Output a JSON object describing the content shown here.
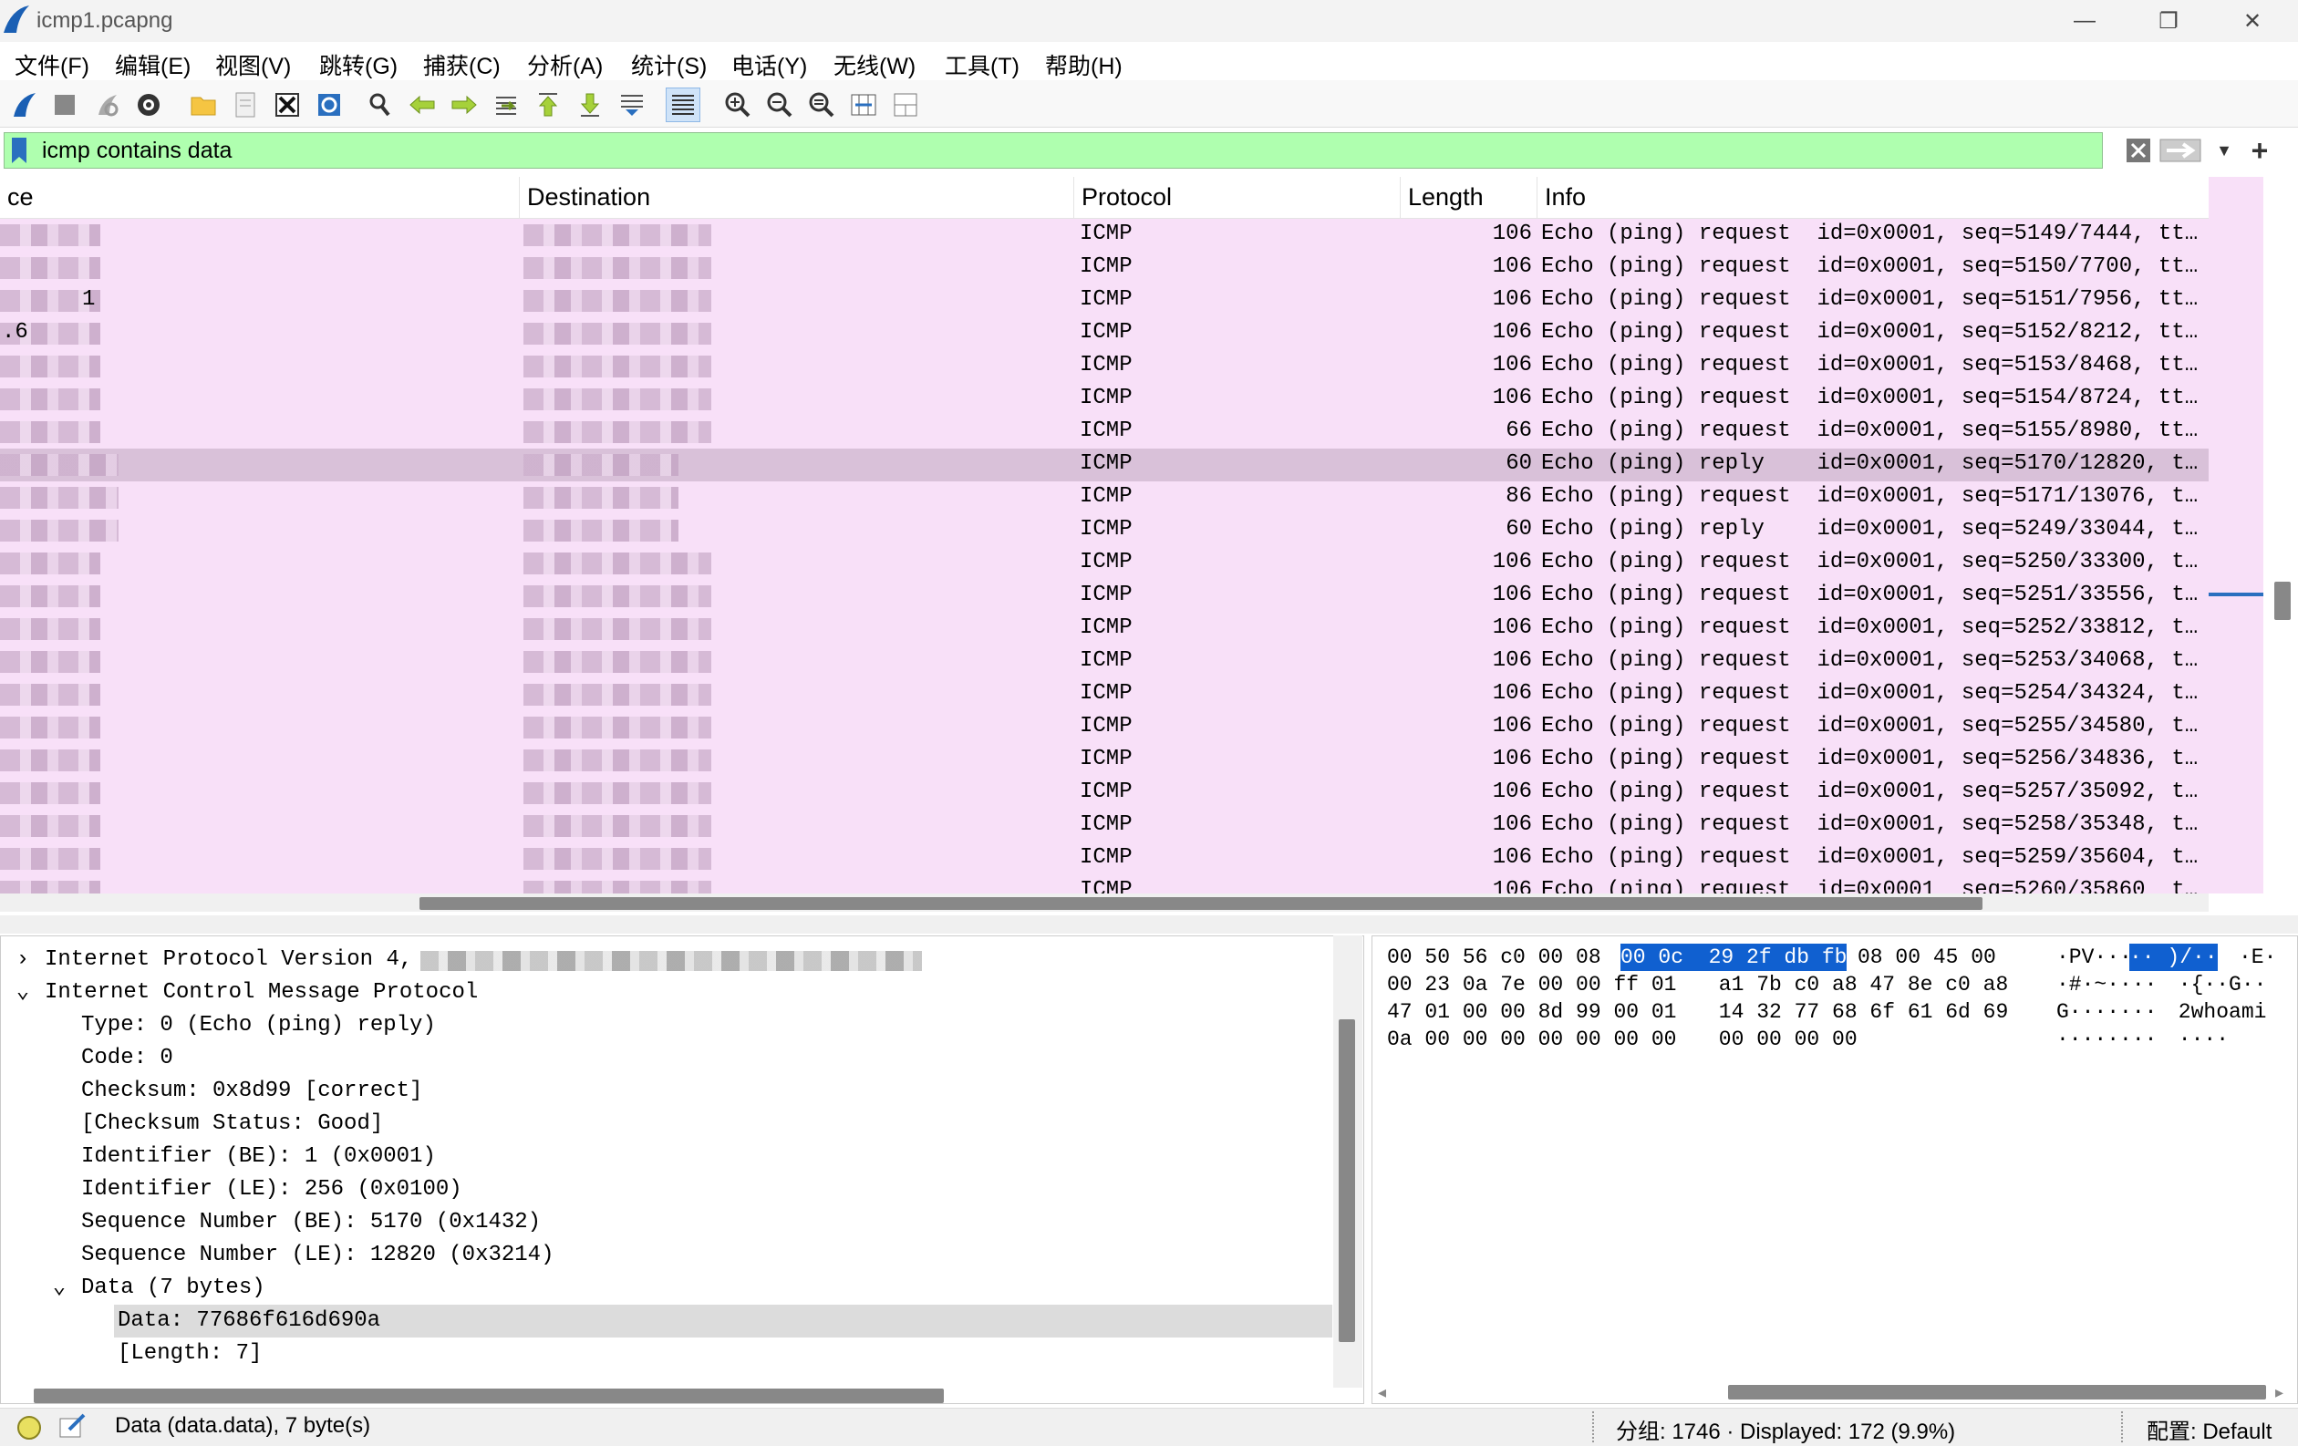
{
  "window": {
    "title": "icmp1.pcapng"
  },
  "menu": [
    {
      "label": "文件(F)"
    },
    {
      "label": "编辑(E)"
    },
    {
      "label": "视图(V)"
    },
    {
      "label": "跳转(G)"
    },
    {
      "label": "捕获(C)"
    },
    {
      "label": "分析(A)"
    },
    {
      "label": "统计(S)"
    },
    {
      "label": "电话(Y)"
    },
    {
      "label": "无线(W)"
    },
    {
      "label": "工具(T)"
    },
    {
      "label": "帮助(H)"
    }
  ],
  "toolbar": {
    "icons": [
      "shark-fin-start-icon",
      "stop-capture-icon",
      "restart-capture-icon",
      "capture-options-icon",
      "open-folder-icon",
      "save-file-icon",
      "close-file-icon",
      "reload-file-icon",
      "find-packet-icon",
      "go-back-icon",
      "go-forward-icon",
      "go-to-packet-icon",
      "go-first-icon",
      "go-last-icon",
      "autoscroll-icon",
      "colorize-icon",
      "zoom-in-icon",
      "zoom-out-icon",
      "zoom-normal-icon",
      "resize-columns-icon",
      "layout-icon"
    ]
  },
  "filter": {
    "value": "icmp contains data",
    "add_label": "+"
  },
  "packet_list": {
    "columns": [
      "ce",
      "Destination",
      "Protocol",
      "Length",
      "Info"
    ],
    "rows": [
      {
        "source": "",
        "protocol": "ICMP",
        "length": "106",
        "info": "Echo (ping) request  id=0x0001, seq=5149/7444, tt…"
      },
      {
        "source": "",
        "protocol": "ICMP",
        "length": "106",
        "info": "Echo (ping) request  id=0x0001, seq=5150/7700, tt…"
      },
      {
        "source": "1",
        "protocol": "ICMP",
        "length": "106",
        "info": "Echo (ping) request  id=0x0001, seq=5151/7956, tt…"
      },
      {
        "source": ".6",
        "protocol": "ICMP",
        "length": "106",
        "info": "Echo (ping) request  id=0x0001, seq=5152/8212, tt…"
      },
      {
        "source": "",
        "protocol": "ICMP",
        "length": "106",
        "info": "Echo (ping) request  id=0x0001, seq=5153/8468, tt…"
      },
      {
        "source": "",
        "protocol": "ICMP",
        "length": "106",
        "info": "Echo (ping) request  id=0x0001, seq=5154/8724, tt…"
      },
      {
        "source": "",
        "protocol": "ICMP",
        "length": "66",
        "info": "Echo (ping) request  id=0x0001, seq=5155/8980, tt…"
      },
      {
        "source": "",
        "protocol": "ICMP",
        "length": "60",
        "info": "Echo (ping) reply    id=0x0001, seq=5170/12820, t…"
      },
      {
        "source": "",
        "protocol": "ICMP",
        "length": "86",
        "info": "Echo (ping) request  id=0x0001, seq=5171/13076, t…"
      },
      {
        "source": "",
        "protocol": "ICMP",
        "length": "60",
        "info": "Echo (ping) reply    id=0x0001, seq=5249/33044, t…"
      },
      {
        "source": "",
        "protocol": "ICMP",
        "length": "106",
        "info": "Echo (ping) request  id=0x0001, seq=5250/33300, t…"
      },
      {
        "source": "",
        "protocol": "ICMP",
        "length": "106",
        "info": "Echo (ping) request  id=0x0001, seq=5251/33556, t…"
      },
      {
        "source": "",
        "protocol": "ICMP",
        "length": "106",
        "info": "Echo (ping) request  id=0x0001, seq=5252/33812, t…"
      },
      {
        "source": "",
        "protocol": "ICMP",
        "length": "106",
        "info": "Echo (ping) request  id=0x0001, seq=5253/34068, t…"
      },
      {
        "source": "",
        "protocol": "ICMP",
        "length": "106",
        "info": "Echo (ping) request  id=0x0001, seq=5254/34324, t…"
      },
      {
        "source": "",
        "protocol": "ICMP",
        "length": "106",
        "info": "Echo (ping) request  id=0x0001, seq=5255/34580, t…"
      },
      {
        "source": "",
        "protocol": "ICMP",
        "length": "106",
        "info": "Echo (ping) request  id=0x0001, seq=5256/34836, t…"
      },
      {
        "source": "",
        "protocol": "ICMP",
        "length": "106",
        "info": "Echo (ping) request  id=0x0001, seq=5257/35092, t…"
      },
      {
        "source": "",
        "protocol": "ICMP",
        "length": "106",
        "info": "Echo (ping) request  id=0x0001, seq=5258/35348, t…"
      },
      {
        "source": "",
        "protocol": "ICMP",
        "length": "106",
        "info": "Echo (ping) request  id=0x0001, seq=5259/35604, t…"
      },
      {
        "source": "",
        "protocol": "ICMP",
        "length": "106",
        "info": "Echo (ping) request  id=0x0001  seq=5260/35860  t…"
      }
    ]
  },
  "details": [
    {
      "text": "Internet Protocol Version 4,",
      "level": 0,
      "expand": "collapsed"
    },
    {
      "text": "Internet Control Message Protocol",
      "level": 0,
      "expand": "expanded"
    },
    {
      "text": "Type: 0 (Echo (ping) reply)",
      "level": 1
    },
    {
      "text": "Code: 0",
      "level": 1
    },
    {
      "text": "Checksum: 0x8d99 [correct]",
      "level": 1
    },
    {
      "text": "[Checksum Status: Good]",
      "level": 1
    },
    {
      "text": "Identifier (BE): 1 (0x0001)",
      "level": 1
    },
    {
      "text": "Identifier (LE): 256 (0x0100)",
      "level": 1
    },
    {
      "text": "Sequence Number (BE): 5170 (0x1432)",
      "level": 1
    },
    {
      "text": "Sequence Number (LE): 12820 (0x3214)",
      "level": 1
    },
    {
      "text": "Data (7 bytes)",
      "level": 1,
      "expand": "expanded"
    },
    {
      "text": "Data: 77686f616d690a",
      "level": 2,
      "highlight": true
    },
    {
      "text": "[Length: 7]",
      "level": 2
    }
  ],
  "bytes": [
    {
      "a": "00 50 56 c0 00 08",
      "hl": "00 0c  29 2f db fb",
      "b": "08 00 45 00",
      "ascii1": "·PV···",
      "asciihl": "·· )/··",
      "ascii2": "·E·"
    },
    {
      "a": "00 23 0a 7e 00 00 ff 01",
      "hl": "",
      "b": " a1 7b c0 a8 47 8e c0 a8",
      "ascii1": "·#·~····",
      "asciihl": "",
      "ascii2": " ·{··G··"
    },
    {
      "a": "47 01 00 00 8d 99 00 01",
      "hl": "",
      "b": " 14 32 77 68 6f 61 6d 69",
      "ascii1": "G·······",
      "asciihl": "",
      "ascii2": " 2whoami"
    },
    {
      "a": "0a 00 00 00 00 00 00 00",
      "hl": "",
      "b": " 00 00 00 00",
      "ascii1": "········",
      "asciihl": "",
      "ascii2": " ····"
    }
  ],
  "status": {
    "field": "Data (data.data), 7 byte(s)",
    "packets": "分组: 1746 · Displayed: 172 (9.9%)",
    "profile": "配置: Default"
  },
  "colors": {
    "row": "#f8e0f8",
    "selected_row": "#d9c1d9",
    "filter_ok": "#afffaf",
    "hex_highlight": "#1060d0"
  }
}
